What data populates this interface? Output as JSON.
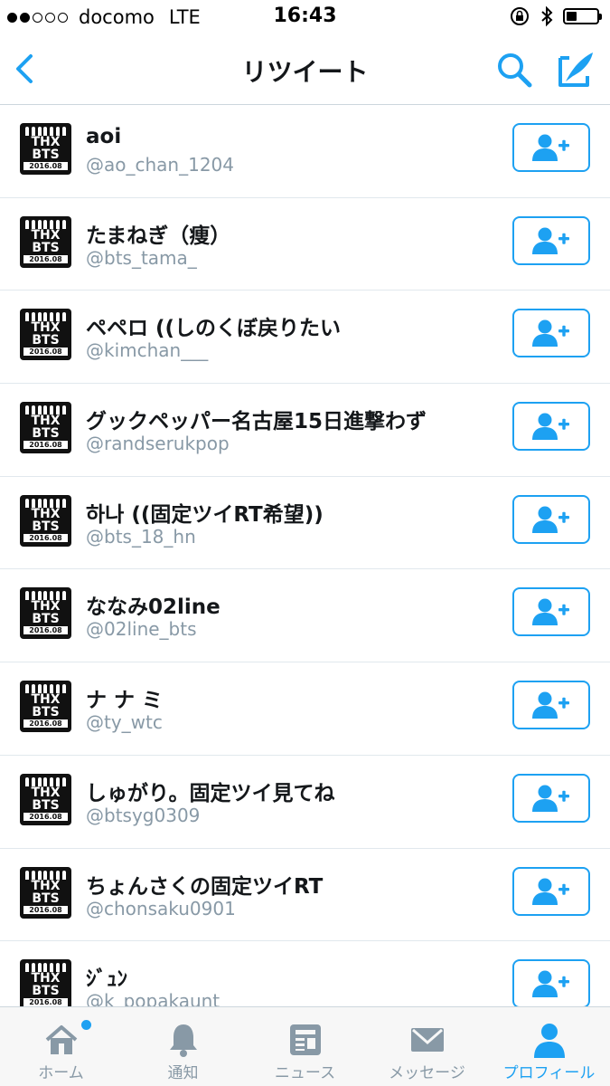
{
  "status_bar": {
    "carrier": "docomo",
    "network": "LTE",
    "time": "16:43",
    "signal_bars_filled": 2,
    "signal_bars_total": 5,
    "battery_level": 0.35
  },
  "nav": {
    "title": "リツイート",
    "back_icon": "chevron-left-icon",
    "search_icon": "search-icon",
    "compose_icon": "compose-icon"
  },
  "avatar_text": {
    "line1": "THX",
    "line2": "BTS",
    "line3": "2016.08"
  },
  "users": [
    {
      "name": "aoi",
      "handle": "@ao_chan_1204"
    },
    {
      "name": "たまねぎ（痩）",
      "handle": "@bts_tama_"
    },
    {
      "name": "ペペロ ((しのくぼ戻りたい",
      "handle": "@kimchan___"
    },
    {
      "name": "グックペッパー名古屋15日進撃わず",
      "handle": "@randserukpop"
    },
    {
      "name": "하나 ((固定ツイRT希望))",
      "handle": "@bts_18_hn"
    },
    {
      "name": "ななみ02line",
      "handle": "@02line_bts"
    },
    {
      "name": "ナ ナ ミ",
      "handle": "@ty_wtc"
    },
    {
      "name": "しゅがり。固定ツイ見てね",
      "handle": "@btsyg0309"
    },
    {
      "name": "ちょんさくの固定ツイRT",
      "handle": "@chonsaku0901"
    },
    {
      "name": "ｼﾞｭﾝ",
      "handle": "@k_popakaunt"
    }
  ],
  "tabs": [
    {
      "label": "ホーム",
      "icon": "home-icon",
      "badge": true
    },
    {
      "label": "通知",
      "icon": "bell-icon",
      "badge": false
    },
    {
      "label": "ニュース",
      "icon": "news-icon",
      "badge": false
    },
    {
      "label": "メッセージ",
      "icon": "envelope-icon",
      "badge": false
    },
    {
      "label": "プロフィール",
      "icon": "person-icon",
      "badge": false,
      "active": true
    }
  ],
  "colors": {
    "accent": "#1da1f2",
    "muted": "#8899a6",
    "text": "#14171a",
    "divider": "#e1e8ed"
  }
}
